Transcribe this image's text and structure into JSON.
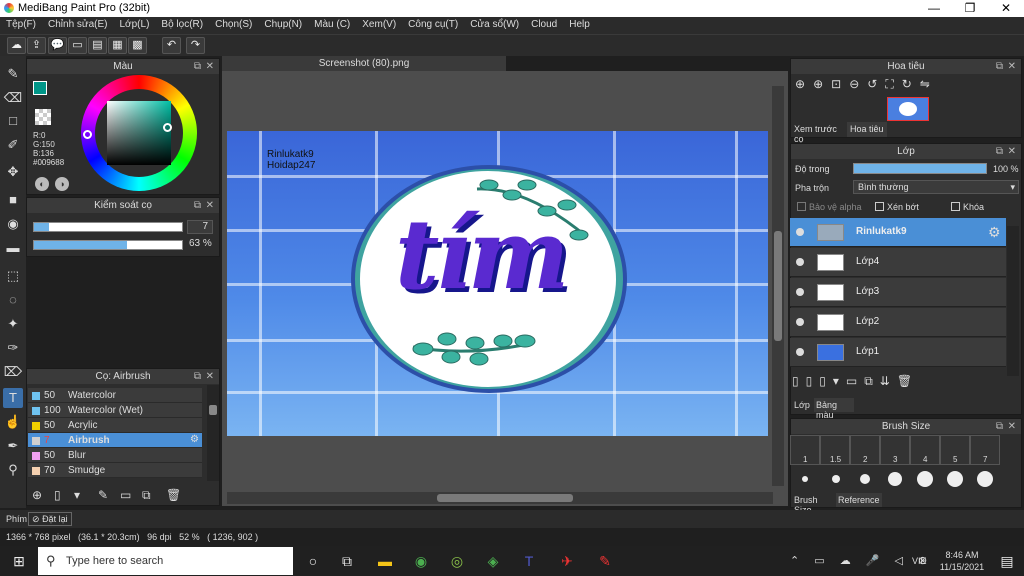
{
  "app": {
    "title": "MediBang Paint Pro (32bit)"
  },
  "window_controls": {
    "minimize": "—",
    "maximize": "❐",
    "close": "✕"
  },
  "menu": [
    "Tệp(F)",
    "Chỉnh sửa(E)",
    "Lớp(L)",
    "Bộ lọc(R)",
    "Chọn(S)",
    "Chụp(N)",
    "Màu (C)",
    "Xem(V)",
    "Công cụ(T)",
    "Cửa sổ(W)",
    "Cloud",
    "Help"
  ],
  "color_panel": {
    "title": "Màu",
    "r": "R:0",
    "g": "G:150",
    "b": "B:136",
    "hex": "#009688"
  },
  "brush_control": {
    "title": "Kiểm soát cọ",
    "size_value": "7",
    "opacity_value": "63 %",
    "size_fraction": 0.1,
    "opacity_fraction": 0.63
  },
  "brush_panel": {
    "title": "Cọ: Airbrush",
    "items": [
      {
        "size": "50",
        "name": "Watercolor",
        "color": "#6fc3f0"
      },
      {
        "size": "100",
        "name": "Watercolor (Wet)",
        "color": "#6fc3f0"
      },
      {
        "size": "50",
        "name": "Acrylic",
        "color": "#f0d000"
      },
      {
        "size": "7",
        "name": "Airbrush",
        "color": "#d0d0d0"
      },
      {
        "size": "50",
        "name": "Blur",
        "color": "#f0a0f0"
      },
      {
        "size": "70",
        "name": "Smudge",
        "color": "#f5d0b0"
      }
    ]
  },
  "canvas_tab": {
    "title": "Screenshot (80).png"
  },
  "canvas_text": {
    "line1": "Rinlukatk9",
    "line2": "Hoidap247",
    "art": "tím"
  },
  "navigator": {
    "title": "Hoa tiêu",
    "tab1": "Xem trước cọ",
    "tab2": "Hoa tiêu"
  },
  "layer_panel": {
    "title": "Lớp",
    "opacity_label": "Độ trong",
    "opacity_value": "100 %",
    "blend_label": "Pha trộn",
    "blend_value": "Bình thường",
    "alpha_protect": "Bảo vệ alpha",
    "clip": "Xén bớt",
    "lock": "Khóa",
    "layers": [
      "Rinlukatk9",
      "Lớp4",
      "Lớp3",
      "Lớp2",
      "Lớp1"
    ],
    "tab1": "Lớp",
    "tab2": "Bảng màu"
  },
  "brush_size_panel": {
    "title": "Brush Size",
    "sizes": [
      "1",
      "1.5",
      "2",
      "3",
      "4",
      "5",
      "7"
    ],
    "tab1": "Brush Size",
    "tab2": "Reference"
  },
  "bottom_bar": {
    "phim": "Phím",
    "reset": "Đặt lại"
  },
  "status": {
    "text": "1366 * 768 pixel   (36.1 * 20.3cm)   96 dpi   52 %   ( 1236, 902 )"
  },
  "taskbar": {
    "search_placeholder": "Type here to search",
    "time": "8:46 AM",
    "date": "11/15/2021",
    "lang": "VIE"
  }
}
